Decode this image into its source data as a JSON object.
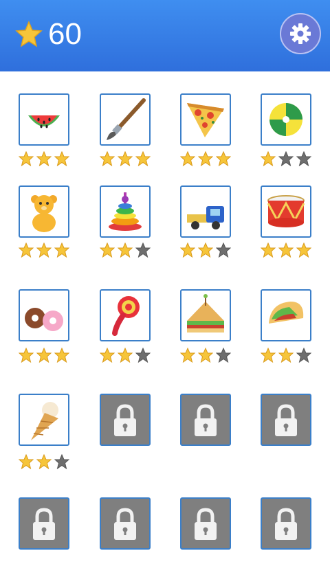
{
  "header": {
    "score": "60",
    "score_icon": "star-icon",
    "settings_icon": "gear-icon"
  },
  "colors": {
    "header": "#3077e4",
    "tile_border": "#3b7fc9",
    "locked": "#7f7f7f",
    "star_on": "#f6c53a",
    "star_off": "#6e6e6e"
  },
  "levels": [
    {
      "item": "watermelon",
      "stars": 3,
      "locked": false
    },
    {
      "item": "paintbrush",
      "stars": 3,
      "locked": false
    },
    {
      "item": "pizza-slice",
      "stars": 3,
      "locked": false
    },
    {
      "item": "beach-ball",
      "stars": 1,
      "locked": false
    },
    {
      "item": "teddy-bear",
      "stars": 3,
      "locked": false
    },
    {
      "item": "stacking-rings",
      "stars": 2,
      "locked": false
    },
    {
      "item": "toy-truck",
      "stars": 2,
      "locked": false
    },
    {
      "item": "drum",
      "stars": 3,
      "locked": false
    },
    {
      "item": "donuts",
      "stars": 3,
      "locked": false
    },
    {
      "item": "rattle",
      "stars": 2,
      "locked": false
    },
    {
      "item": "sandwich",
      "stars": 2,
      "locked": false
    },
    {
      "item": "taco",
      "stars": 2,
      "locked": false
    },
    {
      "item": "ice-cream-cone",
      "stars": 2,
      "locked": false
    },
    {
      "item": "lock",
      "stars": 0,
      "locked": true
    },
    {
      "item": "lock",
      "stars": 0,
      "locked": true
    },
    {
      "item": "lock",
      "stars": 0,
      "locked": true
    },
    {
      "item": "lock",
      "stars": 0,
      "locked": true
    },
    {
      "item": "lock",
      "stars": 0,
      "locked": true
    },
    {
      "item": "lock",
      "stars": 0,
      "locked": true
    },
    {
      "item": "lock",
      "stars": 0,
      "locked": true
    }
  ]
}
